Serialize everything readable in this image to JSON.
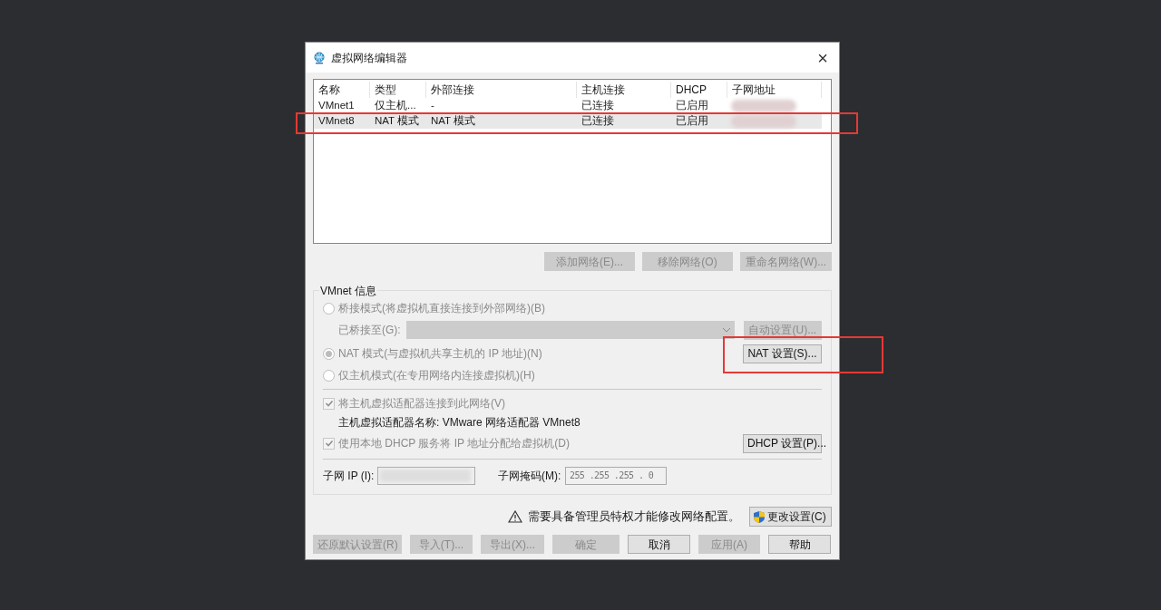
{
  "window": {
    "title": "虚拟网络编辑器",
    "close": "×"
  },
  "network_table": {
    "columns": [
      "名称",
      "类型",
      "外部连接",
      "主机连接",
      "DHCP",
      "子网地址"
    ],
    "rows": [
      {
        "name": "VMnet1",
        "type": "仅主机...",
        "external": "-",
        "host": "已连接",
        "dhcp": "已启用",
        "selected": false,
        "annotated": false
      },
      {
        "name": "VMnet8",
        "type": "NAT 模式",
        "external": "NAT 模式",
        "host": "已连接",
        "dhcp": "已启用",
        "selected": true,
        "annotated": true
      }
    ]
  },
  "list_buttons": [
    {
      "label": "添加网络(E)...",
      "disabled": true
    },
    {
      "label": "移除网络(O)",
      "disabled": true
    },
    {
      "label": "重命名网络(W)...",
      "disabled": true
    }
  ],
  "vmnet_info": {
    "title": "VMnet 信息",
    "modes": [
      {
        "label": "桥接模式(将虚拟机直接连接到外部网络)(B)",
        "selected": false,
        "disabled": true
      },
      {
        "label": "NAT 模式(与虚拟机共享主机的 IP 地址)(N)",
        "selected": true,
        "disabled": true
      },
      {
        "label": "仅主机模式(在专用网络内连接虚拟机)(H)",
        "selected": false,
        "disabled": true
      }
    ],
    "bridged_to": {
      "label": "已桥接至(G):",
      "disabled": true
    },
    "auto_button": {
      "label": "自动设置(U)...",
      "disabled": true
    },
    "nat_button": {
      "label": "NAT 设置(S)...",
      "disabled": false,
      "annotated": true
    },
    "connect_adapter": {
      "label": "将主机虚拟适配器连接到此网络(V)",
      "checked": true,
      "disabled": true
    },
    "adapter_name": "主机虚拟适配器名称: VMware 网络适配器 VMnet8",
    "use_dhcp": {
      "label": "使用本地 DHCP 服务将 IP 地址分配给虚拟机(D)",
      "checked": true,
      "disabled": true
    },
    "dhcp_button": {
      "label": "DHCP 设置(P)...",
      "disabled": false
    },
    "subnet_ip": {
      "label": "子网 IP (I):"
    },
    "subnet_mask": {
      "label": "子网掩码(M):",
      "value": "255 .255 .255 . 0"
    }
  },
  "admin_notice": "需要具备管理员特权才能修改网络配置。",
  "change_button": {
    "label": "更改设置(C)",
    "disabled": false
  },
  "bottom_buttons": [
    {
      "label": "还原默认设置(R)",
      "disabled": true
    },
    {
      "label": "导入(T)...",
      "disabled": true
    },
    {
      "label": "导出(X)...",
      "disabled": true
    },
    {
      "label": "确定",
      "disabled": true
    },
    {
      "label": "取消",
      "disabled": false
    },
    {
      "label": "应用(A)",
      "disabled": true
    },
    {
      "label": "帮助",
      "disabled": false
    }
  ]
}
